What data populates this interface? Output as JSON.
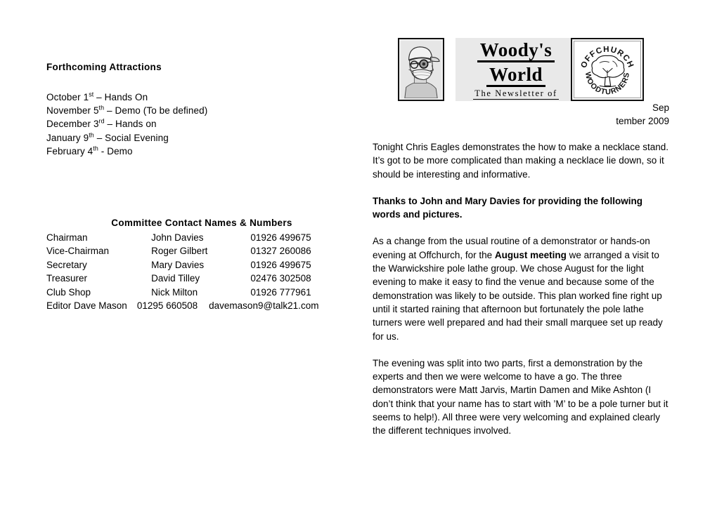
{
  "masthead": {
    "title_line1": "Woody's",
    "title_line2": "World",
    "subtitle": "The  Newsletter  of",
    "face_alt": "woodturner-portrait",
    "logo_top_text": "OFFCHURCH",
    "logo_bottom_text": "WOODTURNERS"
  },
  "date": {
    "line1": "Sep",
    "line2": "tember 2009"
  },
  "forthcoming": {
    "heading": "Forthcoming Attractions",
    "events": [
      {
        "month": "October ",
        "day": "1",
        "ordinal": "st",
        "detail": " – Hands On"
      },
      {
        "month": "November ",
        "day": "5",
        "ordinal": "th",
        "detail": " – Demo (To be defined)"
      },
      {
        "month": "December ",
        "day": "3",
        "ordinal": "rd",
        "detail": " – Hands on"
      },
      {
        "month": "January ",
        "day": "9",
        "ordinal": "th",
        "detail": " – Social Evening"
      },
      {
        "month": "February ",
        "day": "4",
        "ordinal": "th",
        "detail": " - Demo"
      }
    ]
  },
  "committee": {
    "heading": "Committee Contact Names & Numbers",
    "rows": [
      {
        "role": "Chairman",
        "name": "John Davies",
        "phone": "01926 499675"
      },
      {
        "role": "Vice-Chairman",
        "name": "Roger Gilbert",
        "phone": "01327 260086"
      },
      {
        "role": "Secretary",
        "name": "Mary Davies",
        "phone": "01926 499675"
      },
      {
        "role": "Treasurer",
        "name": "David Tilley",
        "phone": "02476 302508"
      },
      {
        "role": "Club Shop",
        "name": "Nick Milton",
        "phone": "01926 777961"
      }
    ],
    "editor": {
      "label": "Editor Dave Mason",
      "phone": "01295 660508",
      "email": "davemason9@talk21.com"
    }
  },
  "article": {
    "intro": "Tonight Chris Eagles demonstrates the how to make a necklace stand.  It’s got to be more complicated than making a necklace lie down, so it should be interesting and informative.",
    "thanks": "Thanks to John and Mary Davies for providing the following words and pictures.",
    "body_1_part1": "As a change from the usual routine of a demonstrator or hands-on evening at Offchurch, for the ",
    "body_1_emphasis": "August meeting",
    "body_1_part2": " we arranged a visit to the Warwickshire pole lathe group.  We chose August for the light evening to make it easy to find the venue and because some of the demonstration was likely to be outside. This plan worked fine right up until it started raining that afternoon but fortunately the pole lathe turners were well prepared and had their small marquee set up ready for us.",
    "body_2": "The evening was split into two parts, first a demonstration by the experts and then we were welcome to have a go. The three demonstrators were Matt Jarvis, Martin Damen and Mike Ashton (I don’t think that your name has to start with ’M’ to be a pole turner but it seems to help!). All three were very welcoming and explained clearly the different techniques involved."
  }
}
